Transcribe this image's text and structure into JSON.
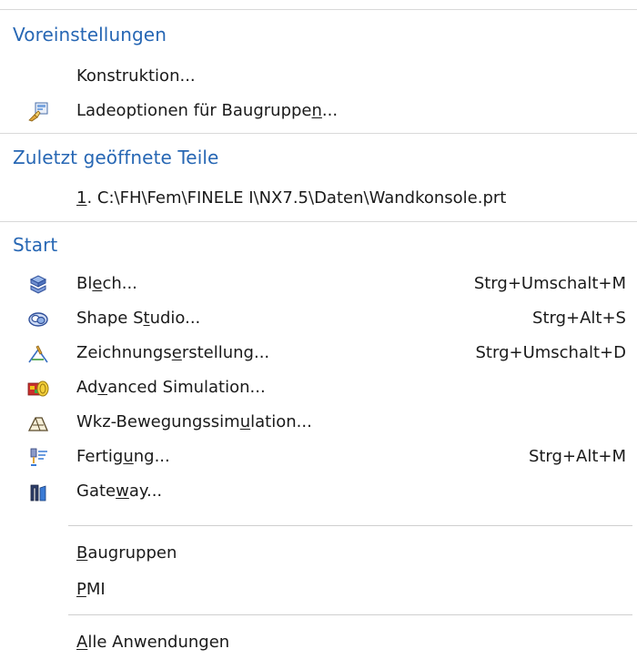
{
  "sections": {
    "preferences": {
      "title": "Voreinstellungen",
      "items": [
        {
          "pre": "Konstruktion...",
          "u": "",
          "post": ""
        },
        {
          "pre": "Ladeoptionen für Baugruppe",
          "u": "n",
          "post": "..."
        }
      ]
    },
    "recent": {
      "title": "Zuletzt geöffnete Teile",
      "items": [
        {
          "pre": "",
          "u": "1",
          "post": ". C:\\FH\\Fem\\FINELE I\\NX7.5\\Daten\\Wandkonsole.prt"
        }
      ]
    },
    "start": {
      "title": "Start",
      "items": [
        {
          "pre": "Bl",
          "u": "e",
          "post": "ch...",
          "shortcut": "Strg+Umschalt+M",
          "icon": "sheet-metal-icon"
        },
        {
          "pre": "Shape S",
          "u": "t",
          "post": "udio...",
          "shortcut": "Strg+Alt+S",
          "icon": "shape-studio-icon"
        },
        {
          "pre": "Zeichnungs",
          "u": "e",
          "post": "rstellung...",
          "shortcut": "Strg+Umschalt+D",
          "icon": "drafting-icon"
        },
        {
          "pre": "Ad",
          "u": "v",
          "post": "anced Simulation...",
          "shortcut": "",
          "icon": "advanced-simulation-icon"
        },
        {
          "pre": "Wkz-Bewegungssim",
          "u": "u",
          "post": "lation...",
          "shortcut": "",
          "icon": "machine-tool-simulation-icon"
        },
        {
          "pre": "Fertig",
          "u": "u",
          "post": "ng...",
          "shortcut": "Strg+Alt+M",
          "icon": "manufacturing-icon"
        },
        {
          "pre": "Gate",
          "u": "w",
          "post": "ay...",
          "shortcut": "",
          "icon": "gateway-icon"
        }
      ],
      "extra_items": [
        {
          "pre": "",
          "u": "B",
          "post": "augruppen"
        },
        {
          "pre": "",
          "u": "P",
          "post": "MI"
        }
      ],
      "all_apps": {
        "pre": "",
        "u": "A",
        "post": "lle Anwendungen"
      }
    }
  },
  "colors": {
    "header": "#2767b4",
    "separator": "#d9d9d9"
  }
}
